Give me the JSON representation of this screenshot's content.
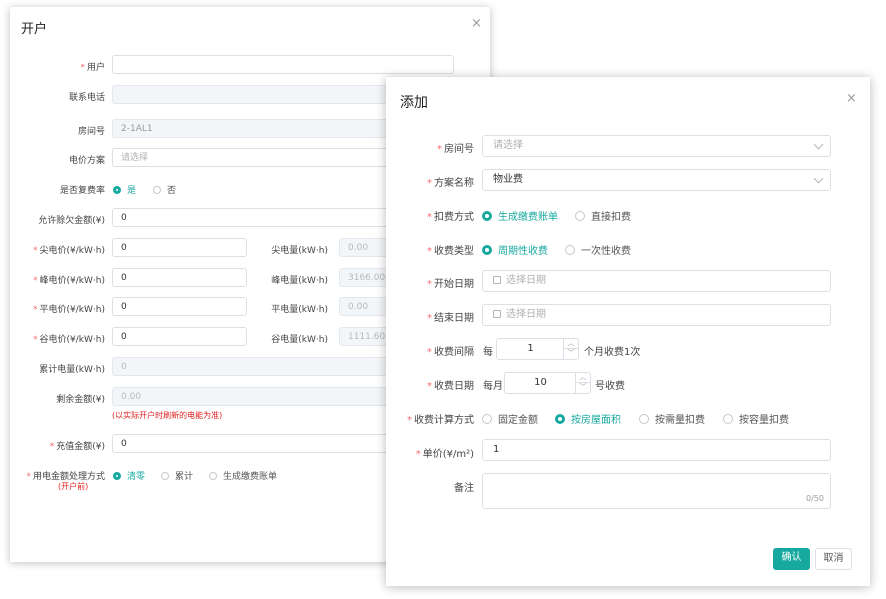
{
  "dialog1": {
    "title": "开户",
    "close": "×",
    "user_label": "用户",
    "phone_label": "联系电话",
    "room_label": "房间号",
    "room_value": "2-1AL1",
    "price_plan_label": "电价方案",
    "price_plan_placeholder": "请选择",
    "multi_rate_label": "是否复费率",
    "multi_rate_options": [
      "是",
      "否"
    ],
    "arrears_label": "允许赊欠金额(¥)",
    "arrears_value": "0",
    "peak_price_label": "尖电价(¥/kW·h)",
    "peak_price_value": "0",
    "peak_energy_label": "尖电量(kW·h)",
    "peak_energy_value": "0.00",
    "high_price_label": "峰电价(¥/kW·h)",
    "high_price_value": "0",
    "high_energy_label": "峰电量(kW·h)",
    "high_energy_value": "3166.00",
    "flat_price_label": "平电价(¥/kW·h)",
    "flat_price_value": "0",
    "flat_energy_label": "平电量(kW·h)",
    "flat_energy_value": "0.00",
    "valley_price_label": "谷电价(¥/kW·h)",
    "valley_price_value": "0",
    "valley_energy_label": "谷电量(kW·h)",
    "valley_energy_value": "1111.60",
    "total_energy_label": "累计电量(kW·h)",
    "total_energy_value": "0",
    "balance_label": "剩余金额(¥)",
    "balance_value": "0.00",
    "balance_note": "(以实际开户时刷新的电能为准)",
    "recharge_label": "充值金额(¥)",
    "recharge_value": "0",
    "handling_label": "用电金额处理方式",
    "handling_sub": "(开户前)",
    "handling_options": [
      "清零",
      "累计",
      "生成缴费账单"
    ]
  },
  "dialog2": {
    "title": "添加",
    "close": "×",
    "room_label": "房间号",
    "room_placeholder": "请选择",
    "plan_label": "方案名称",
    "plan_value": "物业费",
    "deduct_label": "扣费方式",
    "deduct_options": [
      "生成缴费账单",
      "直接扣费"
    ],
    "charge_type_label": "收费类型",
    "charge_type_options": [
      "周期性收费",
      "一次性收费"
    ],
    "start_label": "开始日期",
    "start_placeholder": "选择日期",
    "end_label": "结束日期",
    "end_placeholder": "选择日期",
    "interval_label": "收费间隔",
    "interval_prefix": "每",
    "interval_value": "1",
    "interval_suffix": "个月收费1次",
    "date_label": "收费日期",
    "date_prefix": "每月",
    "date_value": "10",
    "date_suffix": "号收费",
    "calc_label": "收费计算方式",
    "calc_options": [
      "固定金额",
      "按房屋面积",
      "按需量扣费",
      "按容量扣费"
    ],
    "unit_price_label": "单价(¥/m²)",
    "unit_price_value": "1",
    "remark_label": "备注",
    "remark_counter": "0/50",
    "confirm": "确认",
    "cancel": "取消"
  },
  "colors": {
    "accent": "#17a9a0",
    "required": "#f56c6c",
    "note": "#e02020"
  }
}
